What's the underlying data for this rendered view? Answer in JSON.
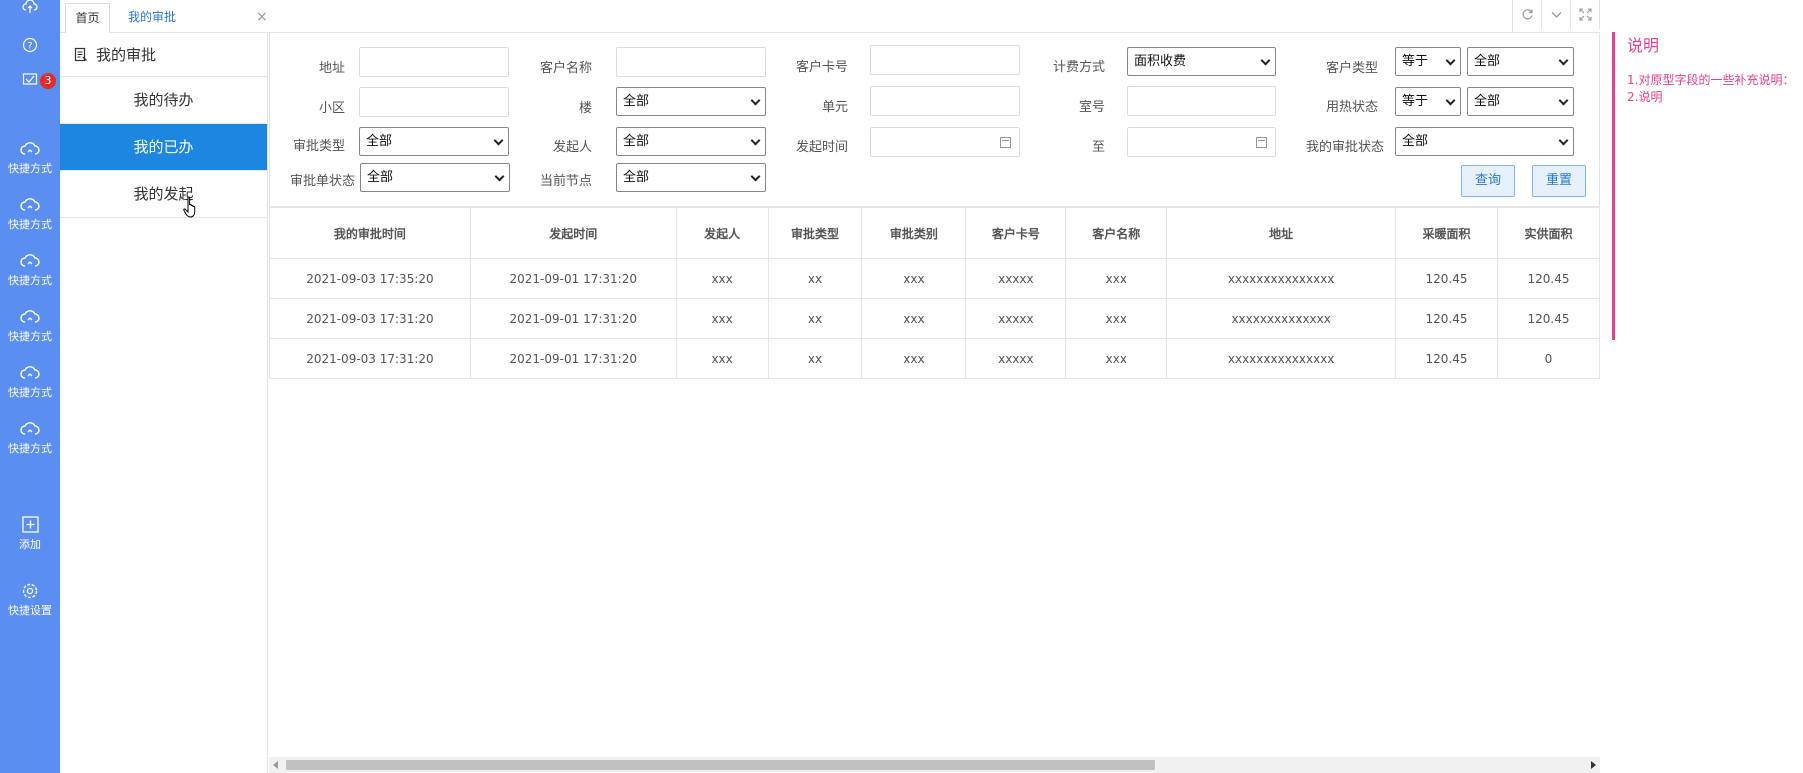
{
  "rail": {
    "badge_count": "3",
    "items": [
      {
        "label": "快捷方式"
      },
      {
        "label": "快捷方式"
      },
      {
        "label": "快捷方式"
      },
      {
        "label": "快捷方式"
      },
      {
        "label": "快捷方式"
      },
      {
        "label": "快捷方式"
      },
      {
        "label": "添加"
      },
      {
        "label": "快捷设置"
      }
    ]
  },
  "tabs": {
    "home": "首页",
    "active": "我的审批",
    "close": "×"
  },
  "submenu": {
    "title": "我的审批",
    "items": [
      "我的待办",
      "我的已办",
      "我的发起"
    ]
  },
  "filters": {
    "address": {
      "label": "地址",
      "value": ""
    },
    "customer_name": {
      "label": "客户名称",
      "value": ""
    },
    "customer_card": {
      "label": "客户卡号",
      "value": ""
    },
    "billing_method": {
      "label": "计费方式",
      "value": "面积收费"
    },
    "customer_type": {
      "label": "客户类型",
      "operator": "等于",
      "value": "全部"
    },
    "community": {
      "label": "小区",
      "value": ""
    },
    "building": {
      "label": "楼",
      "value": "全部"
    },
    "unit": {
      "label": "单元",
      "value": ""
    },
    "room": {
      "label": "室号",
      "value": ""
    },
    "heat_status": {
      "label": "用热状态",
      "operator": "等于",
      "value": "全部"
    },
    "approval_type": {
      "label": "审批类型",
      "value": "全部"
    },
    "initiator": {
      "label": "发起人",
      "value": "全部"
    },
    "start_time": {
      "label": "发起时间",
      "value": ""
    },
    "to": {
      "label": "至",
      "value": ""
    },
    "my_status": {
      "label": "我的审批状态",
      "value": "全部"
    },
    "doc_status": {
      "label": "审批单状态",
      "value": "全部"
    },
    "current_node": {
      "label": "当前节点",
      "value": "全部"
    },
    "query_button": "查询",
    "reset_button": "重置"
  },
  "table": {
    "headers": [
      "我的审批时间",
      "发起时间",
      "发起人",
      "审批类型",
      "审批类别",
      "客户卡号",
      "客户名称",
      "地址",
      "采暖面积",
      "实供面积"
    ],
    "rows": [
      [
        "2021-09-03 17:35:20",
        "2021-09-01 17:31:20",
        "xxx",
        "xx",
        "xxx",
        "xxxxx",
        "xxx",
        "xxxxxxxxxxxxxxx",
        "120.45",
        "120.45"
      ],
      [
        "2021-09-03 17:31:20",
        "2021-09-01 17:31:20",
        "xxx",
        "xx",
        "xxx",
        "xxxxx",
        "xxx",
        "xxxxxxxxxxxxxx",
        "120.45",
        "120.45"
      ],
      [
        "2021-09-03 17:31:20",
        "2021-09-01 17:31:20",
        "xxx",
        "xx",
        "xxx",
        "xxxxx",
        "xxx",
        "xxxxxxxxxxxxxxx",
        "120.45",
        "0"
      ]
    ],
    "type_colors": [
      "#c71c1c",
      "#c71c1c",
      "#2aa52a"
    ]
  },
  "note": {
    "title": "说明",
    "lines": [
      "1.对原型字段的一些补充说明：",
      "2.说明"
    ]
  }
}
